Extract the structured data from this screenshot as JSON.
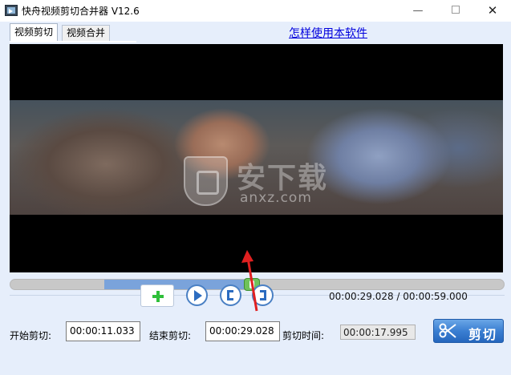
{
  "window": {
    "title": "快舟视频剪切合并器 V12.6",
    "minimize_glyph": "—",
    "close_glyph": "✕"
  },
  "tabs": [
    {
      "label": "视频剪切",
      "active": true
    },
    {
      "label": "视频合并",
      "active": false
    }
  ],
  "help_link": "怎样使用本软件",
  "video": {
    "watermark_text": "安下载",
    "watermark_sub": "anxz.com"
  },
  "timeline": {
    "selection_start_fraction": 0.19,
    "selection_end_fraction": 0.49,
    "playhead_fraction": 0.49
  },
  "controls": {
    "add_icon": "plus-icon",
    "play_icon": "play-icon",
    "mark_in_icon": "bracket-left-icon",
    "mark_out_icon": "bracket-right-icon",
    "time_display": "00:00:29.028 / 00:00:59.000"
  },
  "bottom": {
    "start_label": "开始剪切:",
    "start_value": "00:00:11.033",
    "end_label": "结束剪切:",
    "end_value": "00:00:29.028",
    "duration_label": "剪切时间:",
    "duration_value": "00:00:17.995",
    "cut_button_label": "剪切"
  },
  "colors": {
    "client_bg": "#e6eefb",
    "selection": "#7aa3db",
    "handle": "#6fc25b",
    "link": "#0000dd",
    "cut_button": "#3b7fd2",
    "annotation_arrow": "#e02020"
  }
}
